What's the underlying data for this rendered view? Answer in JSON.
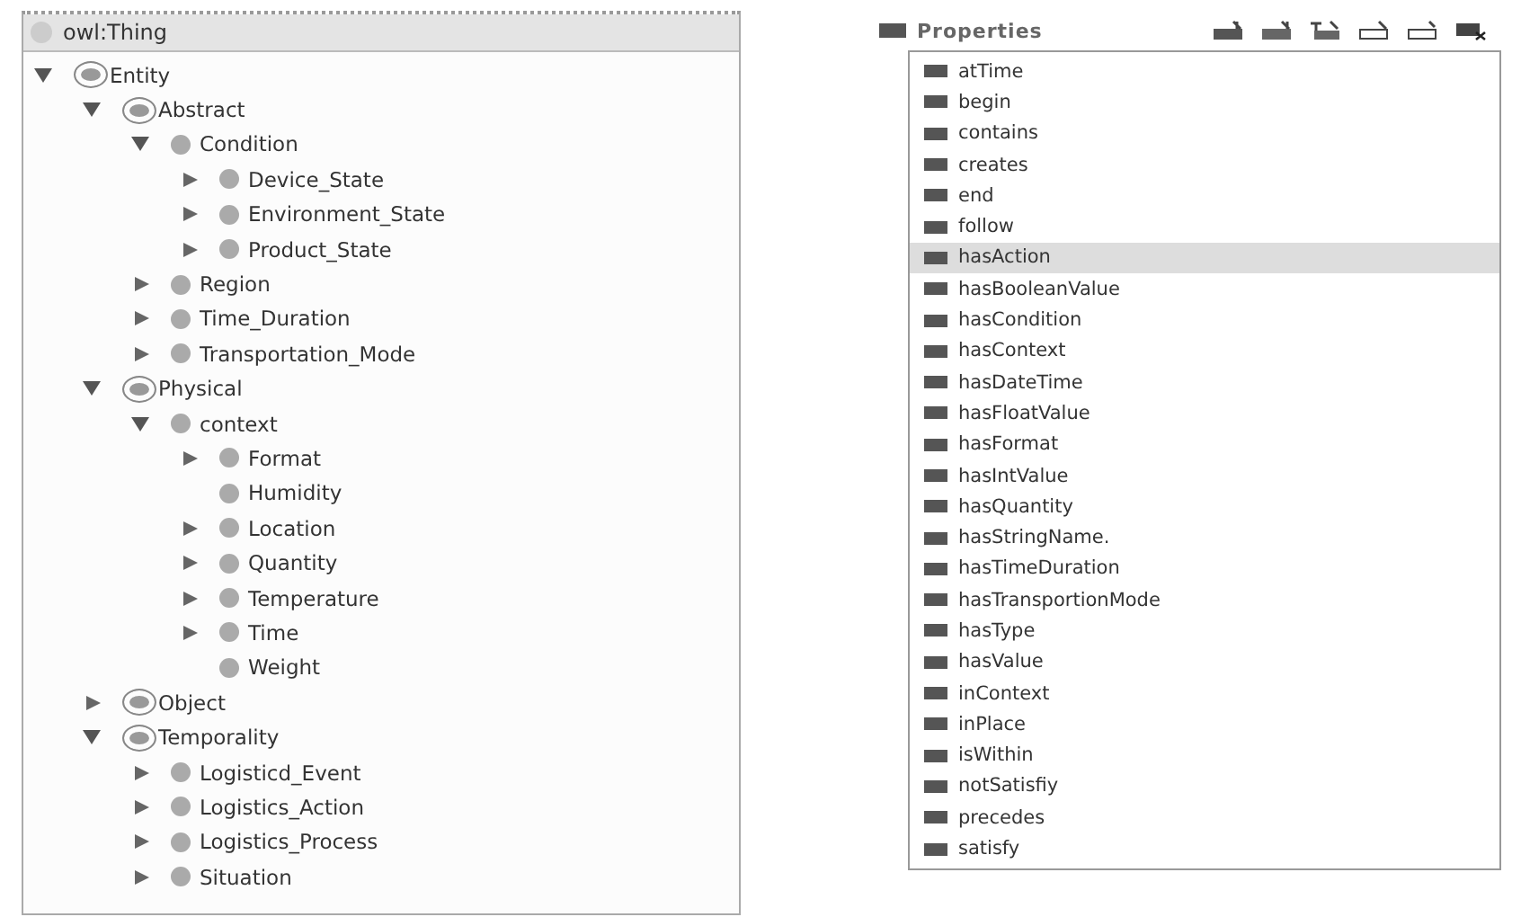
{
  "class_tree": {
    "root": "owl:Thing",
    "items": [
      {
        "label": "Entity",
        "kind": "branch",
        "defined": true,
        "expanded": true,
        "children": [
          {
            "label": "Abstract",
            "kind": "branch",
            "defined": true,
            "expanded": true,
            "children": [
              {
                "label": "Condition",
                "kind": "branch",
                "defined": false,
                "expanded": true,
                "children": [
                  {
                    "label": "Device_State",
                    "kind": "branch",
                    "defined": false,
                    "expanded": false
                  },
                  {
                    "label": "Environment_State",
                    "kind": "branch",
                    "defined": false,
                    "expanded": false
                  },
                  {
                    "label": "Product_State",
                    "kind": "branch",
                    "defined": false,
                    "expanded": false
                  }
                ]
              },
              {
                "label": "Region",
                "kind": "branch",
                "defined": false,
                "expanded": false
              },
              {
                "label": "Time_Duration",
                "kind": "branch",
                "defined": false,
                "expanded": false
              },
              {
                "label": "Transportation_Mode",
                "kind": "branch",
                "defined": false,
                "expanded": false
              }
            ]
          },
          {
            "label": "Physical",
            "kind": "branch",
            "defined": true,
            "expanded": true,
            "children": [
              {
                "label": "context",
                "kind": "branch",
                "defined": false,
                "expanded": true,
                "children": [
                  {
                    "label": "Format",
                    "kind": "branch",
                    "defined": false,
                    "expanded": false
                  },
                  {
                    "label": "Humidity",
                    "kind": "leaf",
                    "defined": false
                  },
                  {
                    "label": "Location",
                    "kind": "branch",
                    "defined": false,
                    "expanded": false
                  },
                  {
                    "label": "Quantity",
                    "kind": "branch",
                    "defined": false,
                    "expanded": false
                  },
                  {
                    "label": "Temperature",
                    "kind": "branch",
                    "defined": false,
                    "expanded": false
                  },
                  {
                    "label": "Time",
                    "kind": "branch",
                    "defined": false,
                    "expanded": false
                  },
                  {
                    "label": "Weight",
                    "kind": "leaf",
                    "defined": false
                  }
                ]
              }
            ]
          },
          {
            "label": "Object",
            "kind": "branch",
            "defined": true,
            "expanded": false
          },
          {
            "label": "Temporality",
            "kind": "branch",
            "defined": true,
            "expanded": true,
            "children": [
              {
                "label": "Logisticd_Event",
                "kind": "branch",
                "defined": false,
                "expanded": false
              },
              {
                "label": "Logistics_Action",
                "kind": "branch",
                "defined": false,
                "expanded": false
              },
              {
                "label": "Logistics_Process",
                "kind": "branch",
                "defined": false,
                "expanded": false
              },
              {
                "label": "Situation",
                "kind": "branch",
                "defined": false,
                "expanded": false
              }
            ]
          }
        ]
      }
    ]
  },
  "properties": {
    "title": "Properties",
    "items": [
      {
        "label": "atTime",
        "selected": false
      },
      {
        "label": "begin",
        "selected": false
      },
      {
        "label": "contains",
        "selected": false
      },
      {
        "label": "creates",
        "selected": false
      },
      {
        "label": "end",
        "selected": false
      },
      {
        "label": "follow",
        "selected": false
      },
      {
        "label": "hasAction",
        "selected": true
      },
      {
        "label": "hasBooleanValue",
        "selected": false
      },
      {
        "label": "hasCondition",
        "selected": false
      },
      {
        "label": "hasContext",
        "selected": false
      },
      {
        "label": "hasDateTime",
        "selected": false
      },
      {
        "label": "hasFloatValue",
        "selected": false
      },
      {
        "label": "hasFormat",
        "selected": false
      },
      {
        "label": "hasIntValue",
        "selected": false
      },
      {
        "label": "hasQuantity",
        "selected": false
      },
      {
        "label": "hasStringName.",
        "selected": false
      },
      {
        "label": "hasTimeDuration",
        "selected": false
      },
      {
        "label": "hasTransportionMode",
        "selected": false
      },
      {
        "label": "hasType",
        "selected": false
      },
      {
        "label": "hasValue",
        "selected": false
      },
      {
        "label": "inContext",
        "selected": false
      },
      {
        "label": "inPlace",
        "selected": false
      },
      {
        "label": "isWithin",
        "selected": false
      },
      {
        "label": "notSatisfiy",
        "selected": false
      },
      {
        "label": "precedes",
        "selected": false
      },
      {
        "label": "satisfy",
        "selected": false
      }
    ]
  }
}
